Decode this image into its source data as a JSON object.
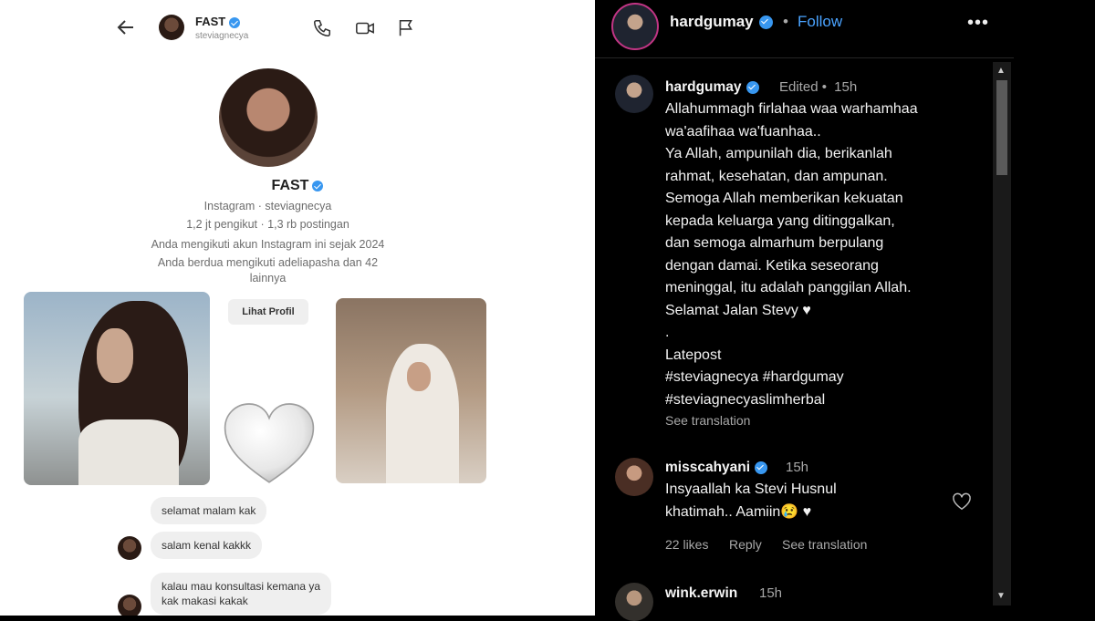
{
  "dm": {
    "header": {
      "name": "FAST",
      "username": "steviagnecya"
    },
    "profile": {
      "name": "FAST",
      "line1": "Instagram · steviagnecya",
      "line2": "1,2 jt pengikut · 1,3 rb postingan",
      "line3": "Anda mengikuti akun Instagram ini sejak 2024",
      "line4": "Anda berdua mengikuti adeliapasha dan 42",
      "line5": "lainnya",
      "view_profile": "Lihat Profil"
    },
    "messages": [
      {
        "text": "selamat malam kak"
      },
      {
        "text": "salam kenal kakkk"
      },
      {
        "text": "kalau mau konsultasi kemana ya\nkak makasi kakak"
      }
    ]
  },
  "post": {
    "username": "hardgumay",
    "follow": "Follow",
    "caption": {
      "username": "hardgumay",
      "edited": "Edited",
      "time": "15h",
      "text": "Allahummagh firlahaa waa warhamhaa\nwa'aafihaa wa'fuanhaa..\nYa Allah, ampunilah dia, berikanlah\nrahmat, kesehatan, dan ampunan.\nSemoga Allah memberikan kekuatan\nkepada keluarga yang ditinggalkan,\ndan semoga almarhum berpulang\ndengan damai. Ketika seseorang\nmeninggal, itu adalah panggilan Allah.\nSelamat Jalan Stevy ♥\n.\nLatepost\n#steviagnecya #hardgumay\n#steviagnecyaslimherbal",
      "see_translation": "See translation"
    },
    "comments": [
      {
        "username": "misscahyani",
        "time": "15h",
        "text": "Insyaallah ka Stevi Husnul\nkhatimah.. Aamiin😢 ♥",
        "likes": "22 likes",
        "reply": "Reply",
        "see_translation": "See translation"
      },
      {
        "username": "wink.erwin",
        "time": "15h"
      }
    ]
  },
  "colors": {
    "link_blue": "#4aa3ff",
    "verified": "#3897f0",
    "story_ring": "#c13584"
  }
}
